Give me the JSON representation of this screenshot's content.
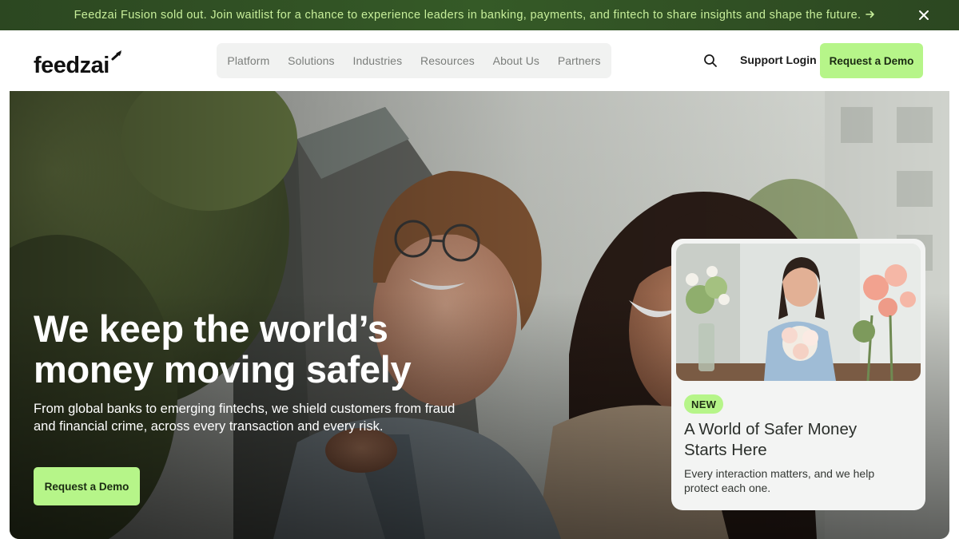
{
  "announcement": {
    "text": "Feedzai Fusion sold out. Join waitlist for a chance to experience leaders in banking, payments, and fintech to share insights and shape the future.",
    "arrow_icon": "arrow-right-icon",
    "close_icon": "close-icon"
  },
  "header": {
    "logo_text": "feedzai",
    "nav": [
      {
        "label": "Platform"
      },
      {
        "label": "Solutions"
      },
      {
        "label": "Industries"
      },
      {
        "label": "Resources"
      },
      {
        "label": "About Us"
      },
      {
        "label": "Partners"
      }
    ],
    "search_icon": "search-icon",
    "support_login": "Support Login",
    "cta": "Request a Demo"
  },
  "hero": {
    "title_line1": "We keep the world’s",
    "title_line2": "money moving safely",
    "subtitle_line1": "From global banks to emerging fintechs, we shield customers from fraud",
    "subtitle_line2": "and financial crime, across every transaction and every risk.",
    "cta": "Request a Demo"
  },
  "card": {
    "badge": "NEW",
    "title_line1": "A World of Safer Money",
    "title_line2": "Starts Here",
    "desc_line1": "Every interaction matters, and we help",
    "desc_line2": "protect each one."
  },
  "colors": {
    "announcement_bg": "#355a27",
    "announcement_text": "#c7ee9a",
    "accent_green": "#b6f589",
    "nav_bg": "#f1f2f1",
    "card_bg": "#f3f4f3"
  }
}
